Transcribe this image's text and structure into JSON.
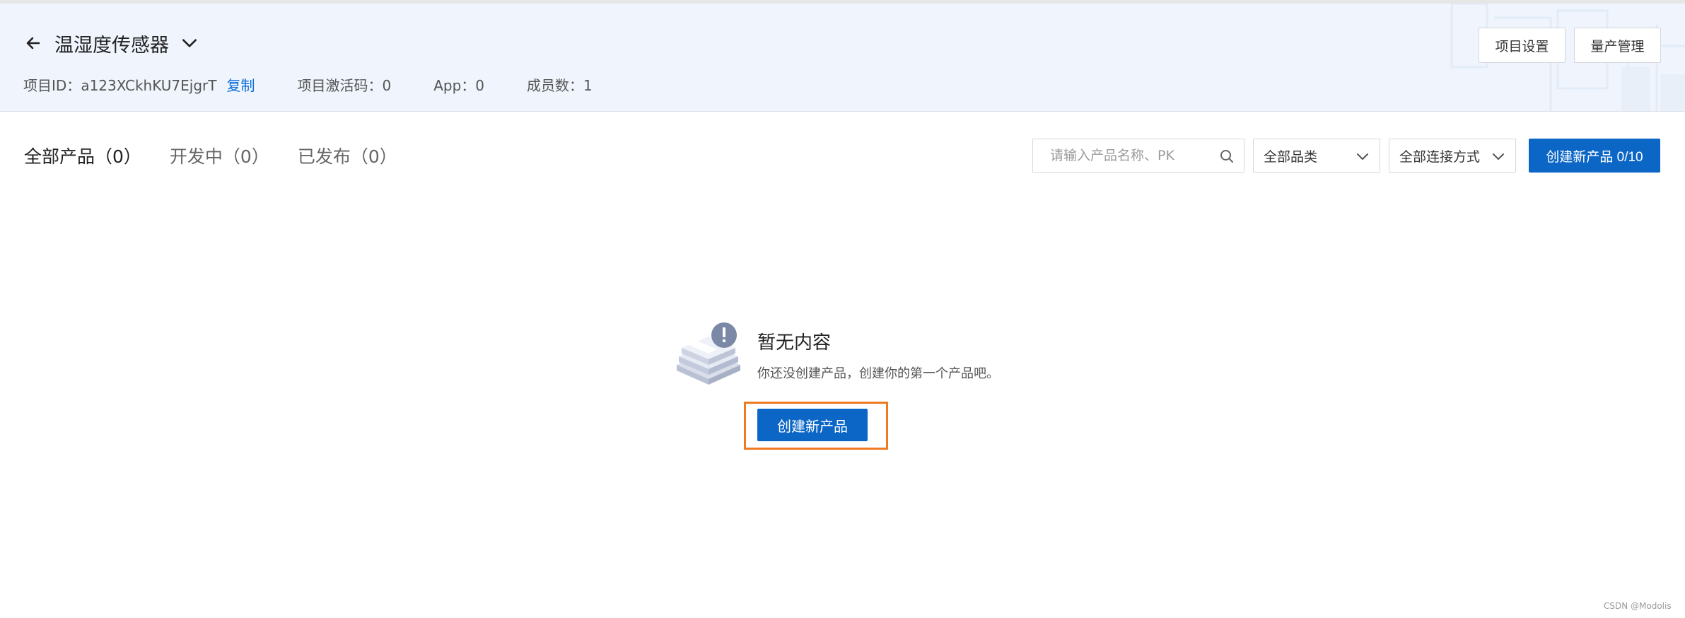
{
  "header": {
    "title": "温湿度传感器",
    "project_id_label": "项目ID：",
    "project_id_value": "a123XCkhKU7EjgrT",
    "copy_label": "复制",
    "activation_label": "项目激活码：",
    "activation_value": "0",
    "app_label": "App：",
    "app_value": "0",
    "members_label": "成员数：",
    "members_value": "1",
    "settings_button": "项目设置",
    "mass_production_button": "量产管理"
  },
  "tabs": [
    {
      "label": "全部产品（0）",
      "active": true
    },
    {
      "label": "开发中（0）",
      "active": false
    },
    {
      "label": "已发布（0）",
      "active": false
    }
  ],
  "toolbar": {
    "search_placeholder": "请输入产品名称、PK",
    "category_select": "全部品类",
    "connection_select": "全部连接方式",
    "create_button": "创建新产品 0/10"
  },
  "empty_state": {
    "title": "暂无内容",
    "description": "你还没创建产品，创建你的第一个产品吧。",
    "create_button": "创建新产品"
  },
  "watermark": "CSDN @Modolis",
  "colors": {
    "header_bg": "#eff4fd",
    "primary": "#0b66c6",
    "link": "#0a6edc",
    "highlight": "#f07a21"
  },
  "icons": [
    "arrow-left-icon",
    "chevron-down-icon",
    "search-icon",
    "caret-down-icon",
    "empty-box-icon"
  ]
}
